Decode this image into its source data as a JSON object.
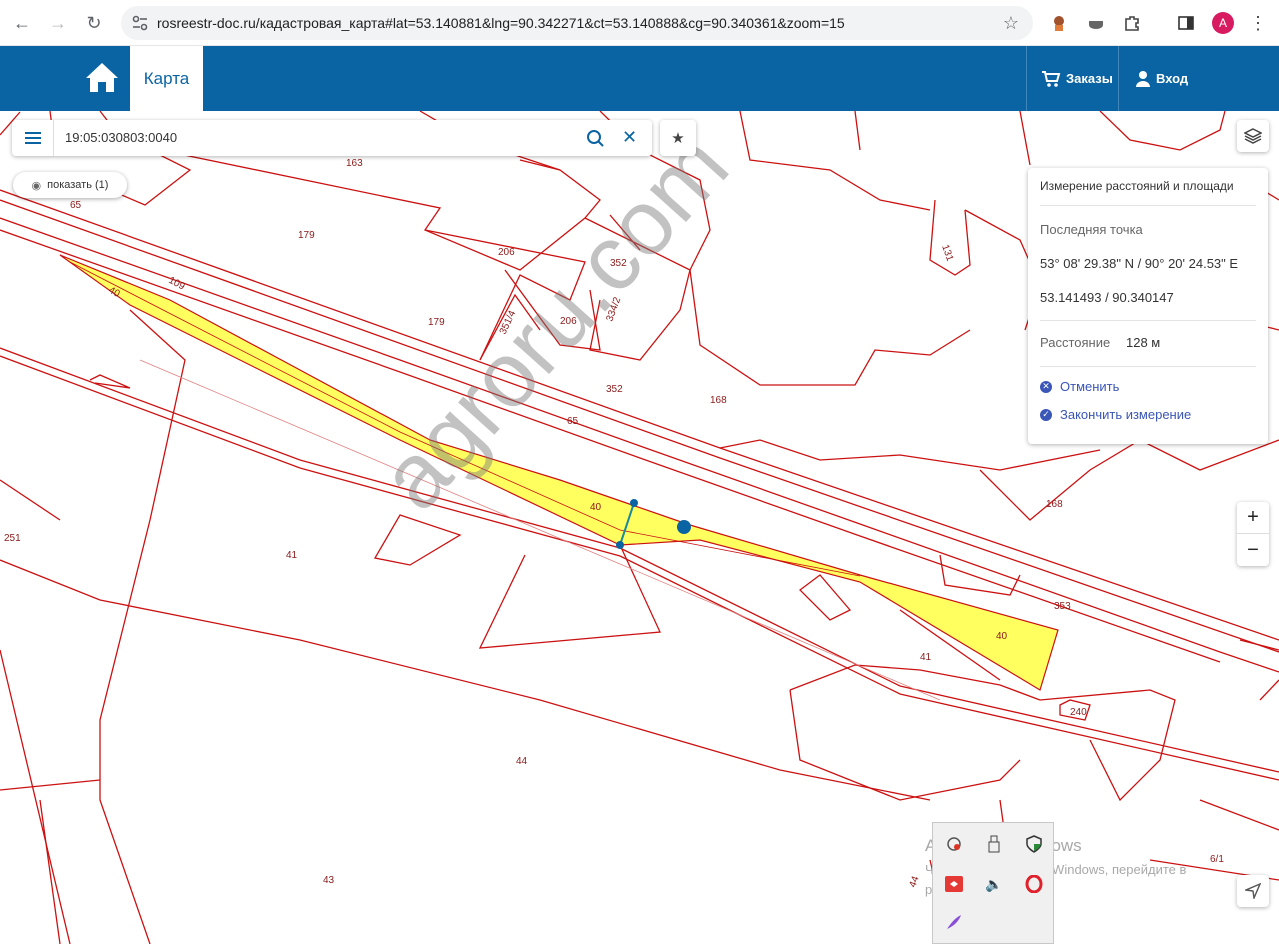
{
  "browser": {
    "url": "rosreestr-doc.ru/кадастровая_карта#lat=53.140881&lng=90.342271&ct=53.140888&cg=90.340361&zoom=15",
    "avatar_letter": "A"
  },
  "header": {
    "tab_map": "Карта",
    "orders": "Заказы",
    "login": "Вход",
    "brand_color": "#0a64a4"
  },
  "search": {
    "value": "19:05:030803:0040",
    "show_label": "показать (1)"
  },
  "measure": {
    "title": "Измерение расстояний и площади",
    "last_point_label": "Последняя точка",
    "coords_dms": "53° 08' 29.38\" N / 90° 20' 24.53\" E",
    "coords_dec": "53.141493 / 90.340147",
    "distance_label": "Расстояние",
    "distance_value": "128 м",
    "cancel": "Отменить",
    "finish": "Закончить измерение"
  },
  "map": {
    "parcel_labels": [
      "163",
      "65",
      "179",
      "109",
      "40",
      "206",
      "352",
      "179",
      "351/4",
      "206",
      "334/2",
      "352",
      "131",
      "168",
      "65",
      "168",
      "40",
      "251",
      "41",
      "353",
      "40",
      "41",
      "240",
      "44",
      "43",
      "44",
      "6/1"
    ],
    "boundary_color": "#cc1111",
    "highlight_color": "#ffff44"
  },
  "watermark": "agroru.com",
  "windows_activation": {
    "heading": "Активация Windows",
    "text1": "Чтобы активировать Windows, перейдите в",
    "text2": "раздел \"Параметры\"."
  },
  "icons": {
    "reload": "reload-icon",
    "star": "star-icon",
    "home": "home-icon",
    "cart": "cart-icon",
    "user": "user-icon",
    "menu": "menu-icon",
    "search": "search-icon",
    "close": "close-icon",
    "layers": "layers-icon",
    "locate": "locate-icon"
  }
}
